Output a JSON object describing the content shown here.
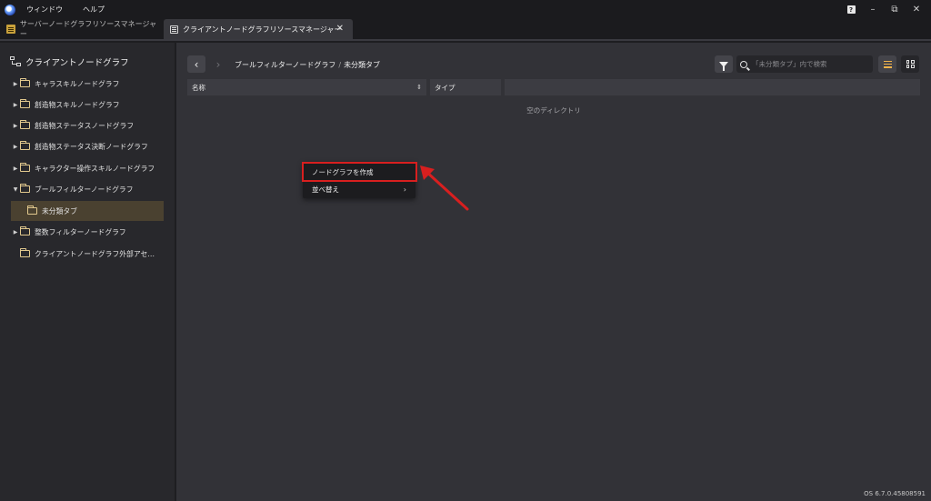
{
  "menubar": {
    "items": [
      "ウィンドウ",
      "ヘルプ"
    ]
  },
  "tabs": [
    {
      "label": "サーバーノードグラフリソースマネージャー",
      "active": false
    },
    {
      "label": "クライアントノードグラフリソースマネージャー",
      "active": true
    }
  ],
  "sidebar": {
    "root_label": "クライアントノードグラフ",
    "items": [
      {
        "label": "キャラスキルノードグラフ",
        "expander": "collapsed"
      },
      {
        "label": "創造物スキルノードグラフ",
        "expander": "collapsed"
      },
      {
        "label": "創造物ステータスノードグラフ",
        "expander": "collapsed"
      },
      {
        "label": "創造物ステータス決断ノードグラフ",
        "expander": "collapsed"
      },
      {
        "label": "キャラクター操作スキルノードグラフ",
        "expander": "collapsed"
      },
      {
        "label": "ブールフィルターノードグラフ",
        "expander": "expanded"
      },
      {
        "label": "未分類タブ",
        "expander": "none",
        "selected": true
      },
      {
        "label": "整数フィルターノードグラフ",
        "expander": "collapsed"
      },
      {
        "label": "クライアントノードグラフ外部アセ…",
        "expander": "none"
      }
    ]
  },
  "toolbar": {
    "breadcrumb": [
      "ブールフィルターノードグラフ",
      "未分類タブ"
    ],
    "breadcrumb_sep": "/",
    "search_placeholder": "「未分類タブ」内で検索"
  },
  "table": {
    "columns": [
      "名称",
      "タイプ",
      ""
    ],
    "empty_message": "空のディレクトリ"
  },
  "context_menu": {
    "items": [
      {
        "label": "ノードグラフを作成",
        "highlighted": true
      },
      {
        "label": "並べ替え",
        "submenu": true
      }
    ]
  },
  "footer": {
    "version": "OS 6.7.0.45808591"
  },
  "colors": {
    "annotation_red": "#d81f1f",
    "accent": "#f0b24a",
    "selected_bg": "#4a4130"
  }
}
